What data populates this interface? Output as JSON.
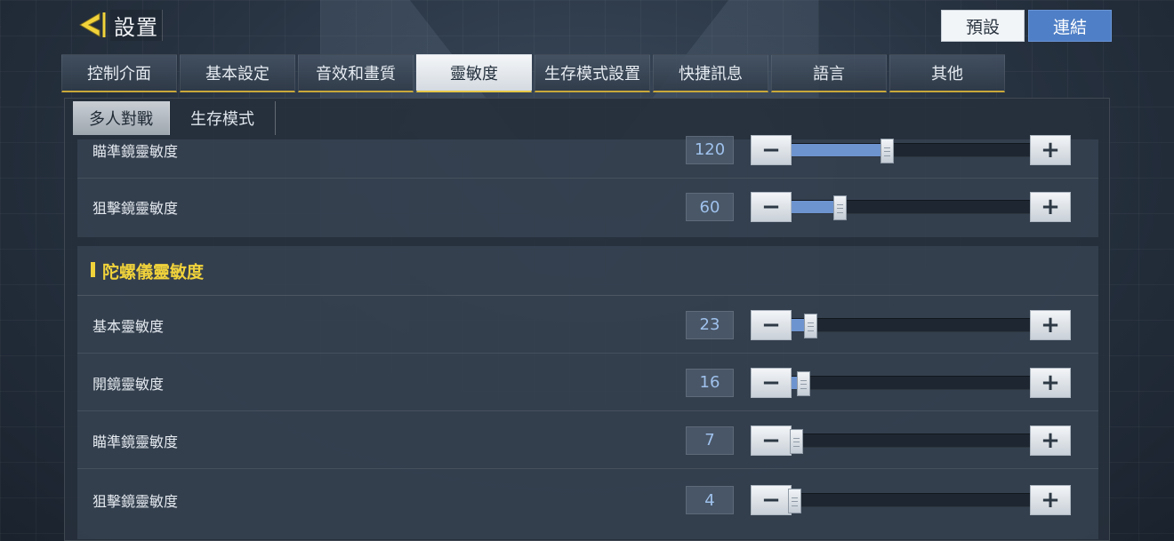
{
  "header": {
    "title": "設置",
    "default_label": "預設",
    "link_label": "連結"
  },
  "tabs": [
    {
      "label": "控制介面",
      "active": false
    },
    {
      "label": "基本設定",
      "active": false
    },
    {
      "label": "音效和畫質",
      "active": false
    },
    {
      "label": "靈敏度",
      "active": true
    },
    {
      "label": "生存模式設置",
      "active": false
    },
    {
      "label": "快捷訊息",
      "active": false
    },
    {
      "label": "語言",
      "active": false
    },
    {
      "label": "其他",
      "active": false
    }
  ],
  "subtabs": [
    {
      "label": "多人對戰",
      "active": true
    },
    {
      "label": "生存模式",
      "active": false
    }
  ],
  "scope_rows": [
    {
      "label": "瞄準鏡靈敏度",
      "value": "120",
      "level_fraction": 0.4
    },
    {
      "label": "狙擊鏡靈敏度",
      "value": "60",
      "level_fraction": 0.2
    }
  ],
  "gyro_section": {
    "title": "陀螺儀靈敏度",
    "rows": [
      {
        "label": "基本靈敏度",
        "value": "23",
        "level_fraction": 0.08
      },
      {
        "label": "開鏡靈敏度",
        "value": "16",
        "level_fraction": 0.05
      },
      {
        "label": "瞄準鏡靈敏度",
        "value": "7",
        "level_fraction": 0.02
      },
      {
        "label": "狙擊鏡靈敏度",
        "value": "4",
        "level_fraction": 0.01
      }
    ]
  },
  "controls": {
    "minus": "−",
    "plus": "+"
  },
  "colors": {
    "accent": "#f0d23b",
    "fill": "#6e94cf",
    "link_button": "#4f7fc6"
  }
}
